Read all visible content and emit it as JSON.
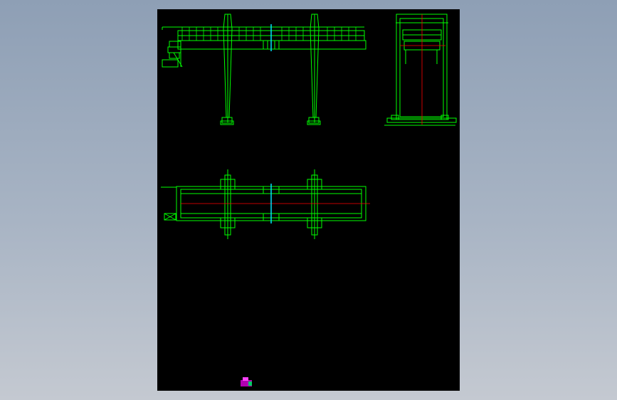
{
  "viewer": {
    "background_top": "#8e9fb5",
    "background_bottom": "#c4c9d1",
    "sheet_background": "#000000"
  },
  "drawing": {
    "line_color": "#00ff00",
    "centerline_color": "#ff0000",
    "axis_color": "#00e5ff",
    "views": [
      "front-elevation",
      "side-elevation",
      "plan-view"
    ],
    "icon": "magenta-cad-marker-icon"
  }
}
